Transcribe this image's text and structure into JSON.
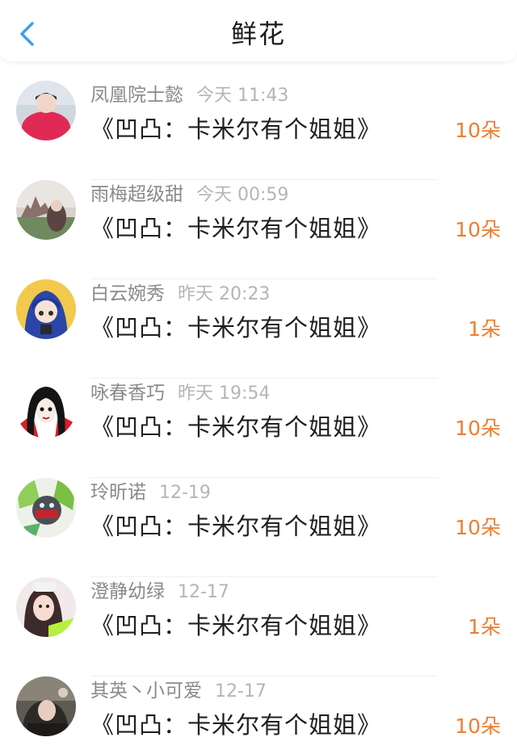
{
  "header": {
    "title": "鲜花",
    "back_icon": "chevron-left-icon",
    "back_color": "#3a9ff5"
  },
  "colors": {
    "amount": "#ee7d2e",
    "name": "#8a8a8a",
    "time": "#b5b5b5",
    "book": "#1f1f1f"
  },
  "items": [
    {
      "name": "凤凰院士懿",
      "time": "今天 11:43",
      "book": "《凹凸：卡米尔有个姐姐》",
      "amount": "10朵"
    },
    {
      "name": "雨梅超级甜",
      "time": "今天 00:59",
      "book": "《凹凸：卡米尔有个姐姐》",
      "amount": "10朵"
    },
    {
      "name": "白云婉秀",
      "time": "昨天 20:23",
      "book": "《凹凸：卡米尔有个姐姐》",
      "amount": "1朵"
    },
    {
      "name": "咏春香巧",
      "time": "昨天 19:54",
      "book": "《凹凸：卡米尔有个姐姐》",
      "amount": "10朵"
    },
    {
      "name": "玲昕诺",
      "time": "12-19",
      "book": "《凹凸：卡米尔有个姐姐》",
      "amount": "10朵"
    },
    {
      "name": "澄静幼绿",
      "time": "12-17",
      "book": "《凹凸：卡米尔有个姐姐》",
      "amount": "1朵"
    },
    {
      "name": "其英丶小可爱",
      "time": "12-17",
      "book": "《凹凸：卡米尔有个姐姐》",
      "amount": "10朵"
    }
  ]
}
